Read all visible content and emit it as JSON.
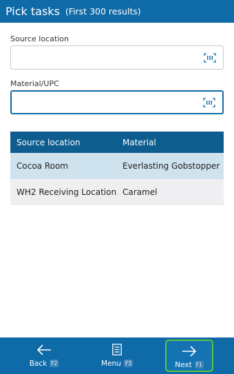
{
  "header": {
    "title": "Pick tasks",
    "subtitle": "(First 300 results)"
  },
  "fields": {
    "source_location": {
      "label": "Source location",
      "value": "",
      "scan_icon": "barcode-scan-icon"
    },
    "material_upc": {
      "label": "Material/UPC",
      "value": "",
      "scan_icon": "barcode-scan-icon"
    }
  },
  "table": {
    "columns": [
      "Source location",
      "Material"
    ],
    "rows": [
      {
        "source_location": "Cocoa Room",
        "material": "Everlasting Gobstopper",
        "selected": true
      },
      {
        "source_location": "WH2 Receiving Location",
        "material": "Caramel",
        "selected": false
      }
    ]
  },
  "footer": {
    "back": {
      "label": "Back",
      "key": "F2",
      "icon": "arrow-left-icon"
    },
    "menu": {
      "label": "Menu",
      "key": "F3",
      "icon": "menu-list-icon"
    },
    "next": {
      "label": "Next",
      "key": "F1",
      "icon": "arrow-right-icon"
    }
  },
  "colors": {
    "brand": "#0f6aa8",
    "table_header": "#0d5d8f",
    "selected_row": "#cfe3ee",
    "row": "#efeff2",
    "next_highlight": "#5fc63a"
  }
}
